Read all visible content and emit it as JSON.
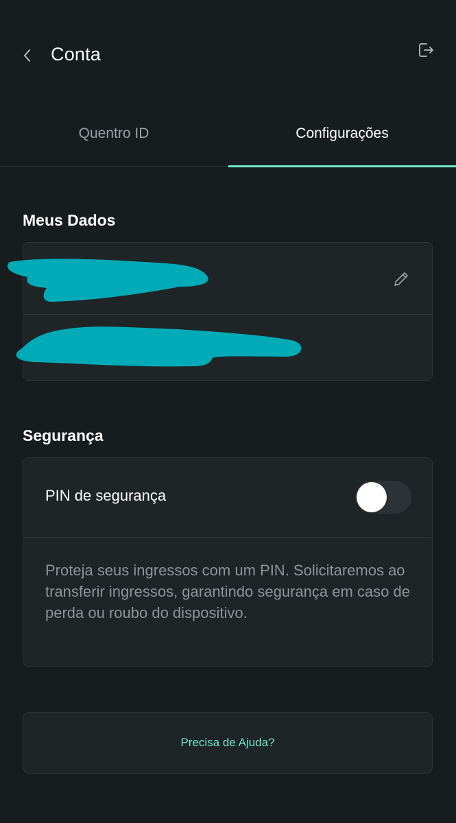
{
  "header": {
    "title": "Conta",
    "back_icon": "chevron-left-icon",
    "logout_icon": "logout-icon"
  },
  "tabs": [
    {
      "label": "Quentro ID",
      "active": false
    },
    {
      "label": "Configurações",
      "active": true
    }
  ],
  "my_data": {
    "title": "Meus Dados",
    "edit_icon": "pencil-icon",
    "redacted": true
  },
  "security": {
    "title": "Segurança",
    "pin_label": "PIN de segurança",
    "pin_enabled": false,
    "description": "Proteja seus ingressos com um PIN. Solicitaremos ao transferir ingressos, garantindo segurança em caso de perda ou roubo do dispositivo."
  },
  "help": {
    "label": "Precisa de Ajuda?"
  },
  "colors": {
    "background": "#171c1e",
    "card": "#1f2427",
    "accent": "#6ee8c4",
    "redaction": "#00aab6"
  }
}
